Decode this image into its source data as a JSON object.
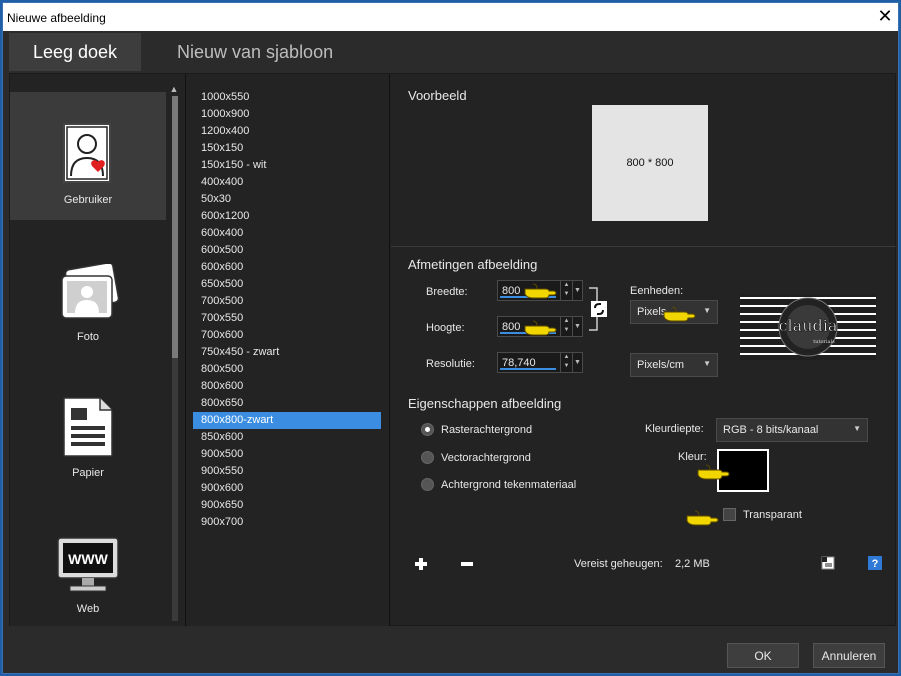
{
  "window": {
    "title": "Nieuwe afbeelding"
  },
  "tabs": [
    {
      "label": "Leeg doek"
    },
    {
      "label": "Nieuw van sjabloon"
    }
  ],
  "categories": [
    {
      "label": "Gebruiker",
      "icon": "user-heart-icon"
    },
    {
      "label": "Foto",
      "icon": "photo-icon"
    },
    {
      "label": "Papier",
      "icon": "document-icon"
    },
    {
      "label": "Web",
      "icon": "www-monitor-icon"
    }
  ],
  "presets": [
    "1000x550",
    "1000x900",
    "1200x400",
    "150x150",
    "150x150 - wit",
    "400x400",
    "50x30",
    "600x1200",
    "600x400",
    "600x500",
    "600x600",
    "650x500",
    "700x500",
    "700x550",
    "700x600",
    "750x450 - zwart",
    "800x500",
    "800x600",
    "800x650",
    "800x800-zwart",
    "850x600",
    "900x500",
    "900x550",
    "900x600",
    "900x650",
    "900x700"
  ],
  "selected_preset": "800x800-zwart",
  "preview": {
    "title": "Voorbeeld",
    "label": "800 * 800"
  },
  "dimensions": {
    "title": "Afmetingen afbeelding",
    "width_label": "Breedte:",
    "width_value": "800",
    "height_label": "Hoogte:",
    "height_value": "800",
    "resolution_label": "Resolutie:",
    "resolution_value": "78,740",
    "units_label": "Eenheden:",
    "units_value": "Pixels",
    "resolution_units_value": "Pixels/cm"
  },
  "properties": {
    "title": "Eigenschappen afbeelding",
    "radio_raster": "Rasterachtergrond",
    "radio_vector": "Vectorachtergrond",
    "radio_material": "Achtergrond tekenmateriaal",
    "color_depth_label": "Kleurdiepte:",
    "color_depth_value": "RGB - 8 bits/kanaal",
    "color_label": "Kleur:",
    "color_value": "#000000",
    "transparent_label": "Transparant"
  },
  "memory": {
    "label": "Vereist geheugen:",
    "value": "2,2 MB"
  },
  "buttons": {
    "ok": "OK",
    "cancel": "Annuleren"
  },
  "logo_text": {
    "main": "claudia",
    "sub": "tutorials"
  },
  "colors": {
    "accent": "#3a8de0",
    "pointer_hand": "#f2d600"
  }
}
